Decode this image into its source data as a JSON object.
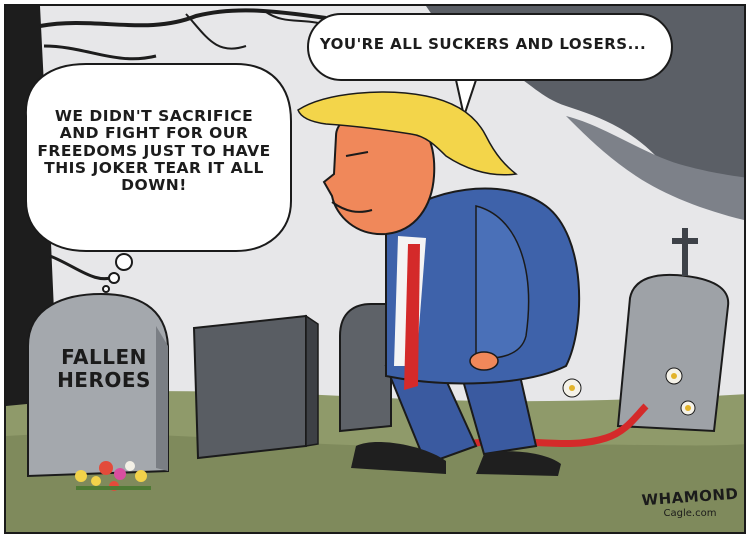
{
  "speech_bubble": {
    "text": "YOU'RE ALL SUCKERS AND LOSERS..."
  },
  "thought_bubble": {
    "text": "WE DIDN'T SACRIFICE AND FIGHT FOR OUR FREEDOMS JUST TO HAVE THIS JOKER TEAR IT ALL DOWN!"
  },
  "tombstone": {
    "line1": "FALLEN",
    "line2": "HEROES"
  },
  "signature": {
    "name": "WHAMOND",
    "site": "Cagle.com"
  },
  "colors": {
    "sky": "#e6e6e8",
    "storm_cloud": "#5a5e66",
    "grass": "#8f9a6a",
    "suit": "#3b5fa8",
    "tie": "#d42a2a",
    "hair": "#f3d54a",
    "skin": "#f0885a",
    "stone": "#9fa3a8"
  }
}
